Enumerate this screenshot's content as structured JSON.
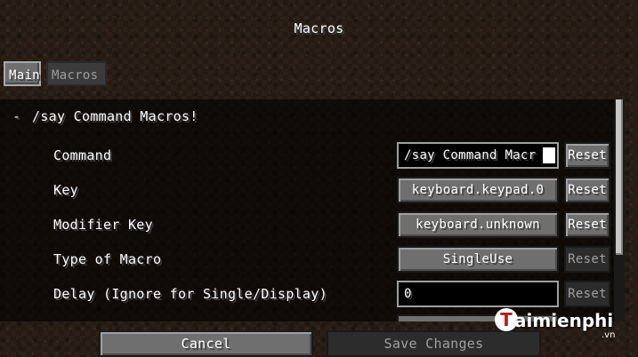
{
  "window": {
    "title": "Macros"
  },
  "tabs": [
    {
      "label": "Main",
      "active": true
    },
    {
      "label": "Macros",
      "active": false
    }
  ],
  "group": {
    "toggle": "-",
    "title": "/say Command Macros!"
  },
  "rows": [
    {
      "label": "Command",
      "value": "/say Command Macr",
      "kind": "text-input-focused",
      "reset": "Reset",
      "reset_enabled": true
    },
    {
      "label": "Key",
      "value": "keyboard.keypad.0",
      "kind": "button",
      "reset": "Reset",
      "reset_enabled": true
    },
    {
      "label": "Modifier Key",
      "value": "keyboard.unknown",
      "kind": "button",
      "reset": "Reset",
      "reset_enabled": true
    },
    {
      "label": "Type of Macro",
      "value": "SingleUse",
      "kind": "button",
      "reset": "Reset",
      "reset_enabled": false
    },
    {
      "label": "Delay (Ignore for Single/Display)",
      "value": "0",
      "kind": "text-input",
      "reset": "Reset",
      "reset_enabled": false
    }
  ],
  "footer": {
    "cancel_label": "Cancel",
    "save_label": "Save Changes"
  },
  "watermark": {
    "logo_letter": "T",
    "name": "aimienphi",
    "suffix": ".vn"
  },
  "colors": {
    "button_face": "#6f6f6f",
    "disabled_face": "#2c2c2c",
    "panel_overlay": "rgba(0,0,0,0.62)",
    "text": "#ffffff",
    "disabled_text": "#a0a0a0"
  }
}
